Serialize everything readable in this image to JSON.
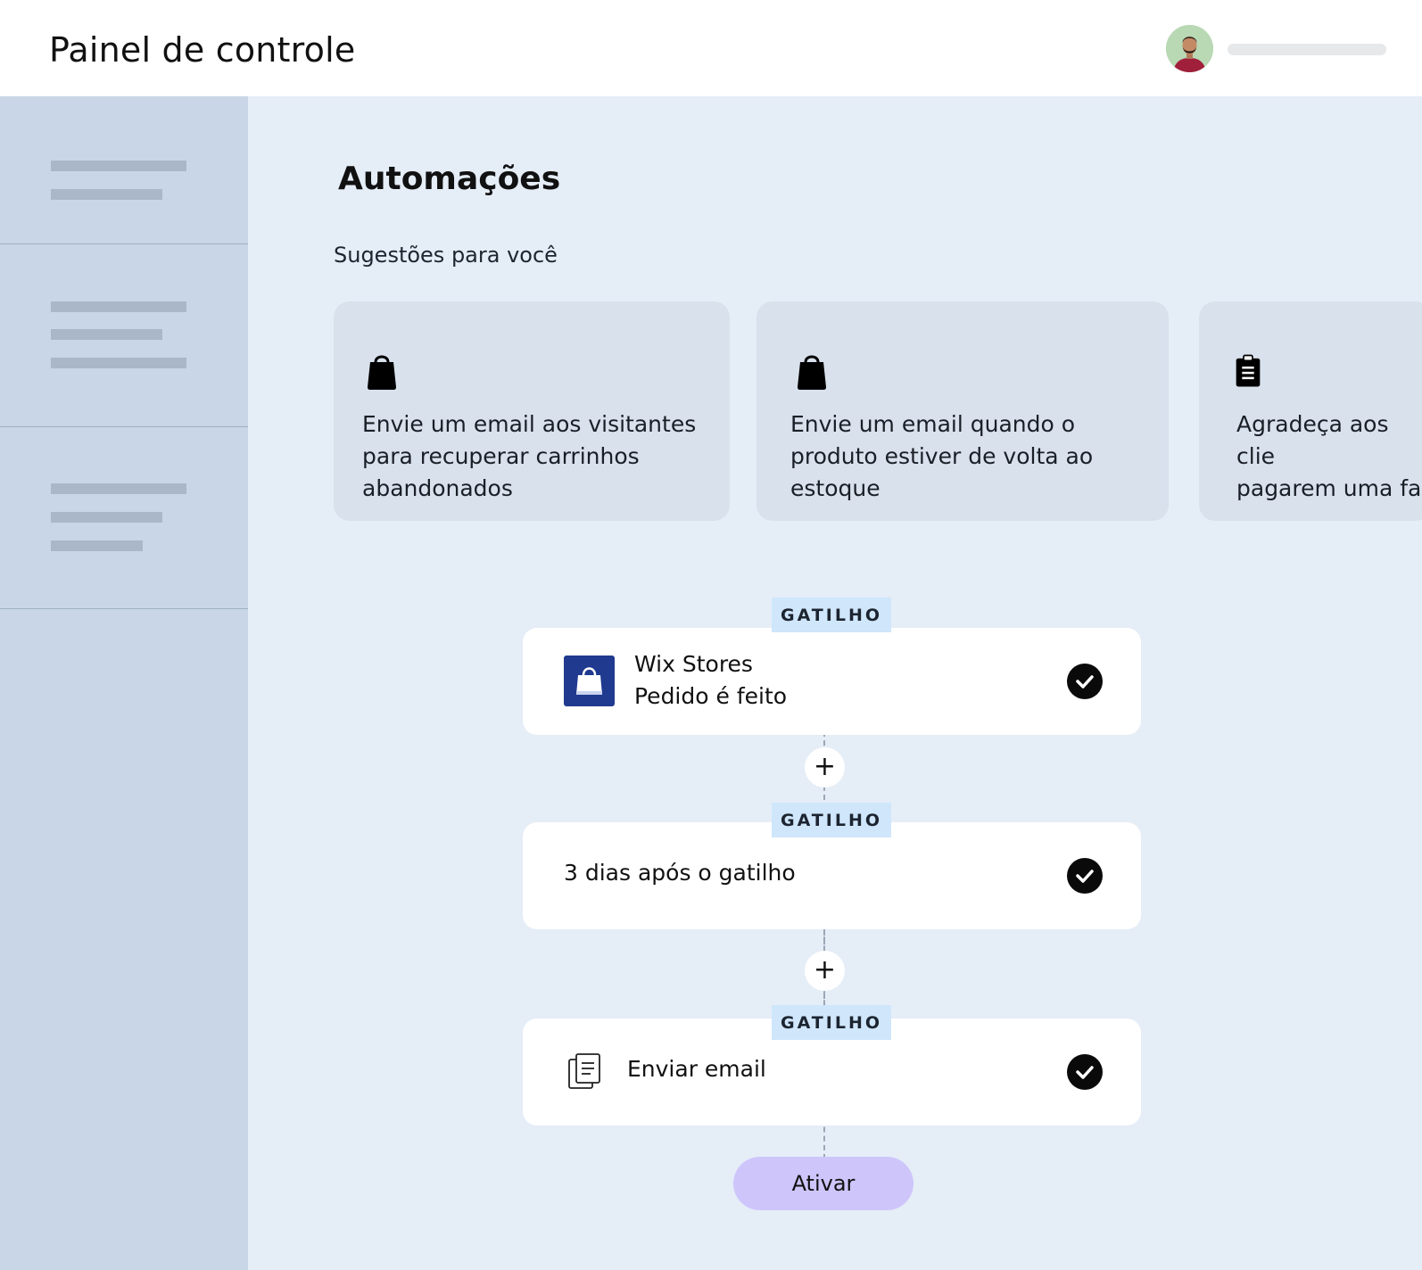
{
  "header": {
    "title": "Painel de controle"
  },
  "main": {
    "title": "Automações",
    "subtitle": "Sugestões para você",
    "cards": [
      {
        "icon": "shopping-bag-icon",
        "text": "Envie um email aos visitantes\npara recuperar carrinhos\nabandonados"
      },
      {
        "icon": "shopping-bag-icon",
        "text": "Envie um email quando o\nproduto estiver de volta ao\nestoque"
      },
      {
        "icon": "clipboard-icon",
        "text": "Agradeça aos clie\npagarem uma fat"
      }
    ]
  },
  "flow": {
    "badge_label": "GATILHO",
    "steps": [
      {
        "app": "Wix Stores",
        "action": "Pedido é feito",
        "icon": "store-bag-icon"
      },
      {
        "text": "3 dias após o gatilho"
      },
      {
        "text": "Enviar email",
        "icon": "email-document-icon"
      }
    ],
    "add_symbol": "+",
    "activate_label": "Ativar"
  },
  "colors": {
    "page_bg": "#e5edf7",
    "sidebar_bg": "#c8d6e7",
    "card_bg": "#d8e1ec",
    "badge_bg": "#cfe6fb",
    "store_icon_bg": "#1f3a8f",
    "activate_bg": "#cec5fb"
  }
}
